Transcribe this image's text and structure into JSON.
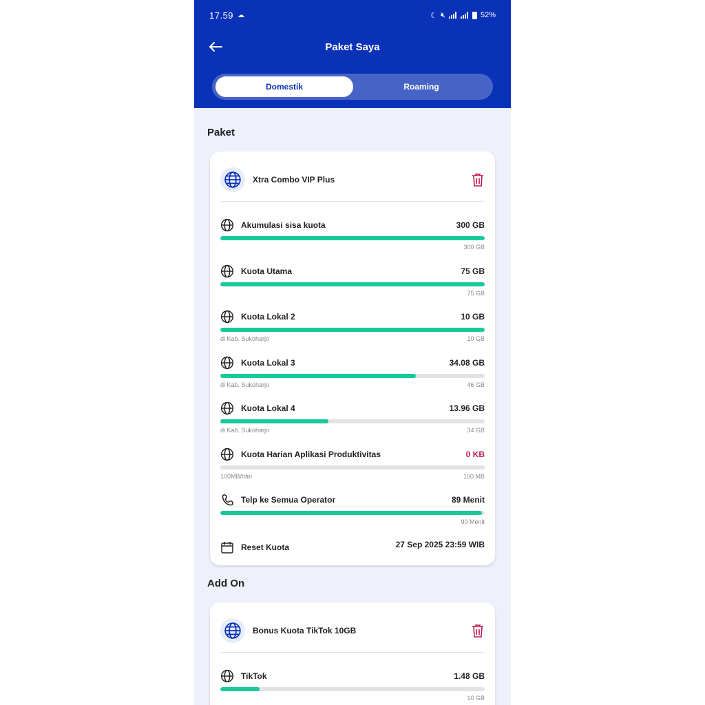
{
  "status_bar": {
    "time": "17.59",
    "battery": "52%"
  },
  "header": {
    "title": "Paket Saya"
  },
  "tabs": [
    {
      "label": "Domestik",
      "active": true
    },
    {
      "label": "Roaming",
      "active": false
    }
  ],
  "paket_section": {
    "title": "Paket",
    "package_name": "Xtra Combo VIP Plus",
    "items": [
      {
        "icon": "globe-icon",
        "label": "Akumulasi sisa kuota",
        "value": "300 GB",
        "progress": 1.0,
        "sub_left": "",
        "sub_right": "300 GB"
      },
      {
        "icon": "globe-icon",
        "label": "Kuota Utama",
        "value": "75 GB",
        "progress": 1.0,
        "sub_left": "",
        "sub_right": "75 GB"
      },
      {
        "icon": "globe-icon",
        "label": "Kuota Lokal 2",
        "value": "10 GB",
        "progress": 1.0,
        "sub_left": "di Kab. Sukoharjo",
        "sub_right": "10 GB"
      },
      {
        "icon": "globe-icon",
        "label": "Kuota Lokal 3",
        "value": "34.08 GB",
        "progress": 0.74,
        "sub_left": "di Kab. Sukoharjo",
        "sub_right": "46 GB"
      },
      {
        "icon": "globe-icon",
        "label": "Kuota Lokal 4",
        "value": "13.96 GB",
        "progress": 0.41,
        "sub_left": "di Kab. Sukoharjo",
        "sub_right": "34 GB"
      },
      {
        "icon": "globe-icon",
        "label": "Kuota Harian Aplikasi Produktivitas",
        "value": "0 KB",
        "progress": 0.0,
        "sub_left": "100MB/hari",
        "sub_right": "100 MB"
      },
      {
        "icon": "phone-icon",
        "label": "Telp ke Semua Operator",
        "value": "89 Menit",
        "progress": 0.99,
        "sub_left": "",
        "sub_right": "90 Menit"
      }
    ],
    "reset_label": "Reset Kuota",
    "reset_date": "27 Sep 2025 23:59 WIB"
  },
  "addon_section": {
    "title": "Add On",
    "package_name": "Bonus Kuota TikTok 10GB",
    "items": [
      {
        "icon": "globe-icon",
        "label": "TikTok",
        "value": "1.48 GB",
        "progress": 0.148,
        "sub_left": "",
        "sub_right": "10 GB"
      }
    ]
  },
  "colors": {
    "primary": "#0a32b8",
    "progress": "#18c99a",
    "danger": "#c0184a",
    "background": "#eef1fb"
  }
}
